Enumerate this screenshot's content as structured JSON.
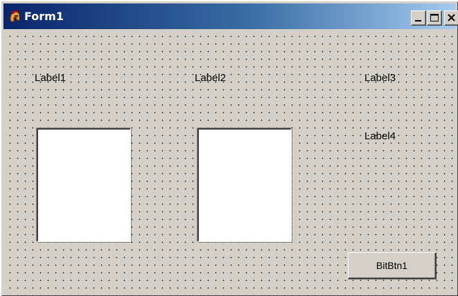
{
  "window": {
    "title": "Form1",
    "icon": "spartan-helmet-icon",
    "controls": {
      "minimize": "minimize-icon",
      "maximize": "maximize-icon",
      "close": "close-icon"
    }
  },
  "form": {
    "labels": [
      "Label1",
      "Label2",
      "Label3",
      "Label4"
    ],
    "button_label": "BitBtn1"
  },
  "colors": {
    "titlebar_start": "#0a246a",
    "titlebar_end": "#a6caf0",
    "form_background": "#d4d0c8",
    "panel_background": "#ffffff"
  }
}
